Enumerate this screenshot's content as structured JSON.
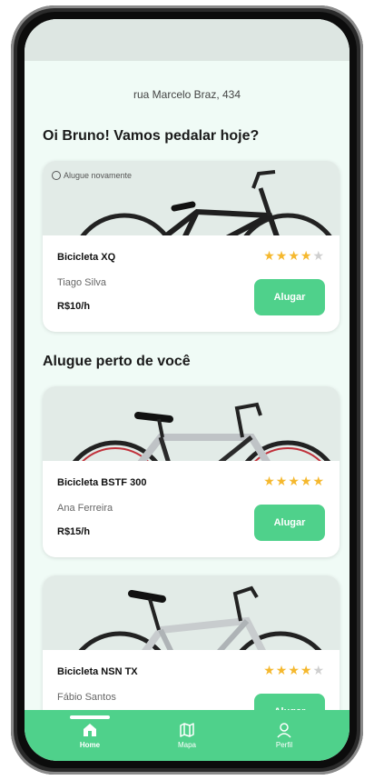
{
  "header": {
    "address": "rua Marcelo Braz, 434",
    "greeting": "Oi Bruno! Vamos pedalar hoje?"
  },
  "recent": {
    "badge": "Alugue novamente",
    "name": "Bicicleta XQ",
    "owner": "Tiago Silva",
    "price": "R$10/h",
    "rating": 4,
    "button": "Alugar"
  },
  "nearby": {
    "title": "Alugue perto de você",
    "items": [
      {
        "name": "Bicicleta BSTF 300",
        "owner": "Ana Ferreira",
        "price": "R$15/h",
        "rating": 5,
        "button": "Alugar"
      },
      {
        "name": "Bicicleta NSN TX",
        "owner": "Fábio Santos",
        "price": "",
        "rating": 4,
        "button": "Alugar"
      }
    ]
  },
  "nav": {
    "items": [
      {
        "label": "Home",
        "icon": "home-icon",
        "active": true
      },
      {
        "label": "Mapa",
        "icon": "map-icon",
        "active": false
      },
      {
        "label": "Perfil",
        "icon": "user-icon",
        "active": false
      }
    ]
  },
  "colors": {
    "accent": "#4fd18b",
    "star": "#f5b82e",
    "background": "#f0fbf6"
  }
}
